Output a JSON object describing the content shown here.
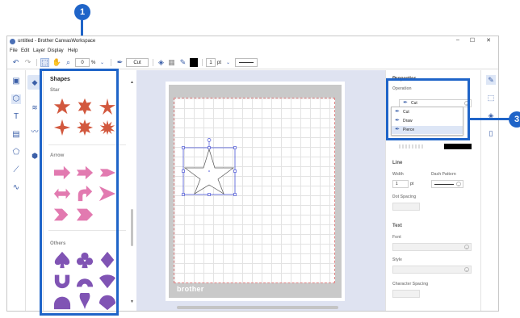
{
  "window": {
    "title": "untitled - Brother CanvasWorkspace",
    "controls": [
      "–",
      "☐",
      "✕"
    ]
  },
  "menu": [
    "File",
    "Edit",
    "Layer",
    "Display",
    "Help"
  ],
  "toolbar": {
    "zoom_value": "0",
    "zoom_unit": "%",
    "operation_value": "Cut",
    "line_width_value": "1",
    "line_width_unit": "pt"
  },
  "shapes_panel": {
    "title": "Shapes",
    "sections": [
      {
        "label": "Star"
      },
      {
        "label": "Arrow"
      },
      {
        "label": "Others"
      }
    ]
  },
  "canvas": {
    "brand": "brother"
  },
  "properties": {
    "title": "Properties",
    "operation_label": "Operation",
    "operation_value": "Cut",
    "operation_options": [
      "Cut",
      "Draw",
      "Pierce"
    ],
    "line_section": "Line",
    "width_label": "Width",
    "width_value": "1",
    "width_unit": "pt",
    "dash_label": "Dash Pattern",
    "dot_spacing_label": "Dot Spacing",
    "text_section": "Text",
    "font_label": "Font",
    "style_label": "Style",
    "char_spacing_label": "Character Spacing"
  },
  "callouts": [
    "1",
    "3"
  ],
  "colors": {
    "accent": "#1f64c8",
    "shape_star": "#d2583e",
    "shape_arrow": "#e27ab0",
    "shape_other": "#8054b4",
    "icon": "#3b5fa8"
  }
}
